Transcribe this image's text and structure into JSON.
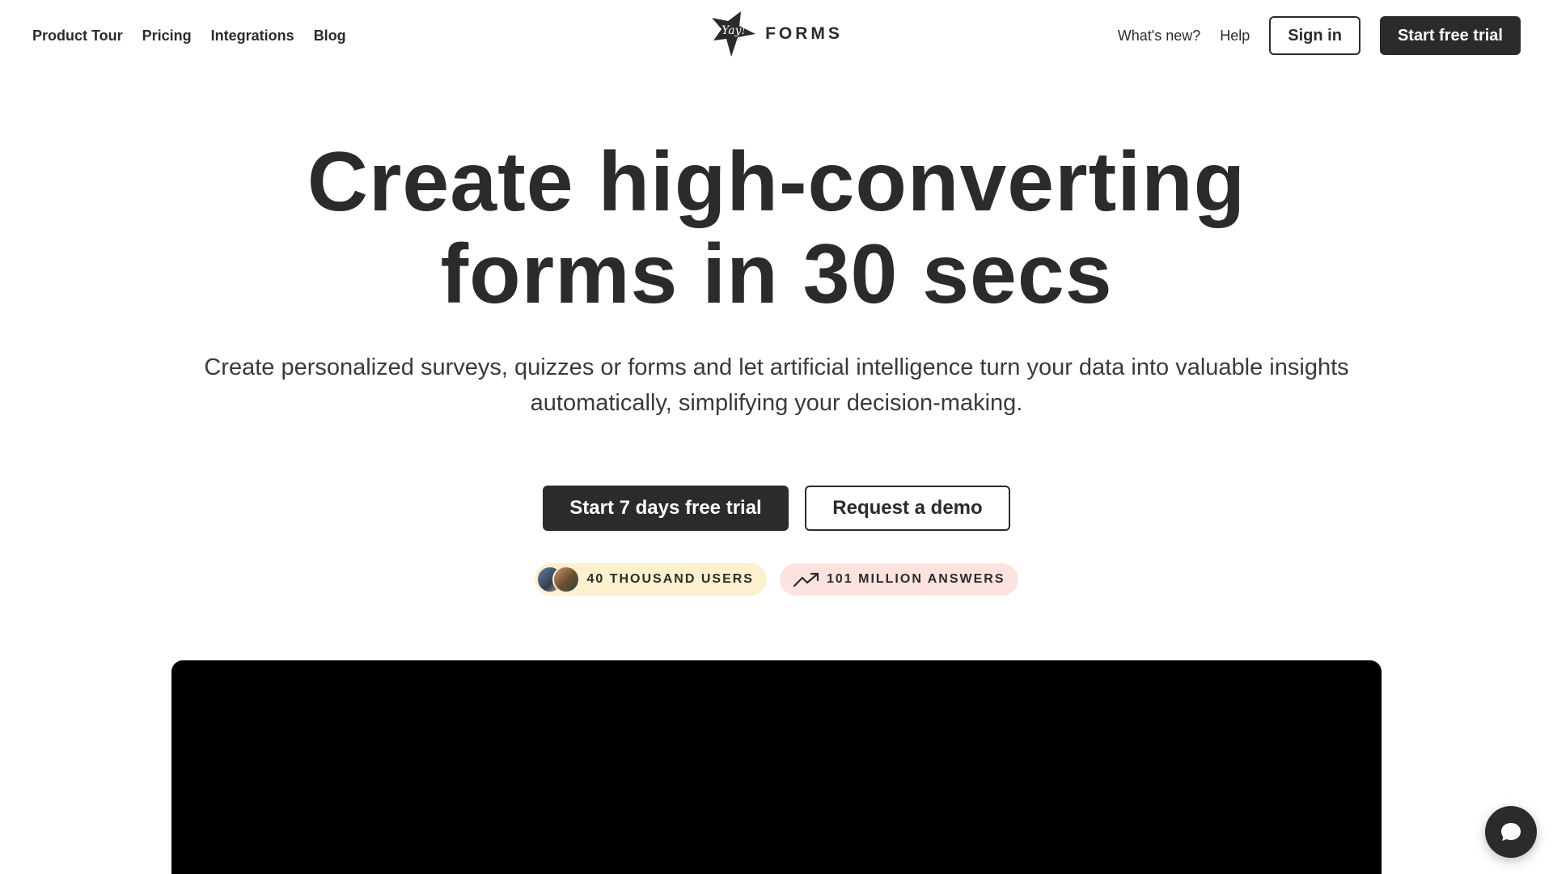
{
  "nav": {
    "left": [
      "Product Tour",
      "Pricing",
      "Integrations",
      "Blog"
    ],
    "logo_mark_text": "Yay!",
    "logo_word": "FORMS",
    "whats_new": "What's new?",
    "help": "Help",
    "sign_in": "Sign in",
    "start_trial": "Start free trial"
  },
  "hero": {
    "title_line1": "Create high-converting",
    "title_line2": "forms in 30 secs",
    "subtitle_line1": "Create personalized surveys, quizzes or forms and let artificial intelligence turn your data into valuable insights",
    "subtitle_line2": "automatically, simplifying your decision-making."
  },
  "cta": {
    "primary": "Start 7 days free trial",
    "secondary": "Request a demo"
  },
  "stats": {
    "users": "40 THOUSAND USERS",
    "answers": "101 MILLION ANSWERS"
  },
  "colors": {
    "dark": "#2b2b2b",
    "users_badge": "#fdf0cf",
    "answers_badge": "#fde3df"
  },
  "icons": {
    "trend": "trending-up-icon",
    "chat": "chat-bubble-icon"
  }
}
